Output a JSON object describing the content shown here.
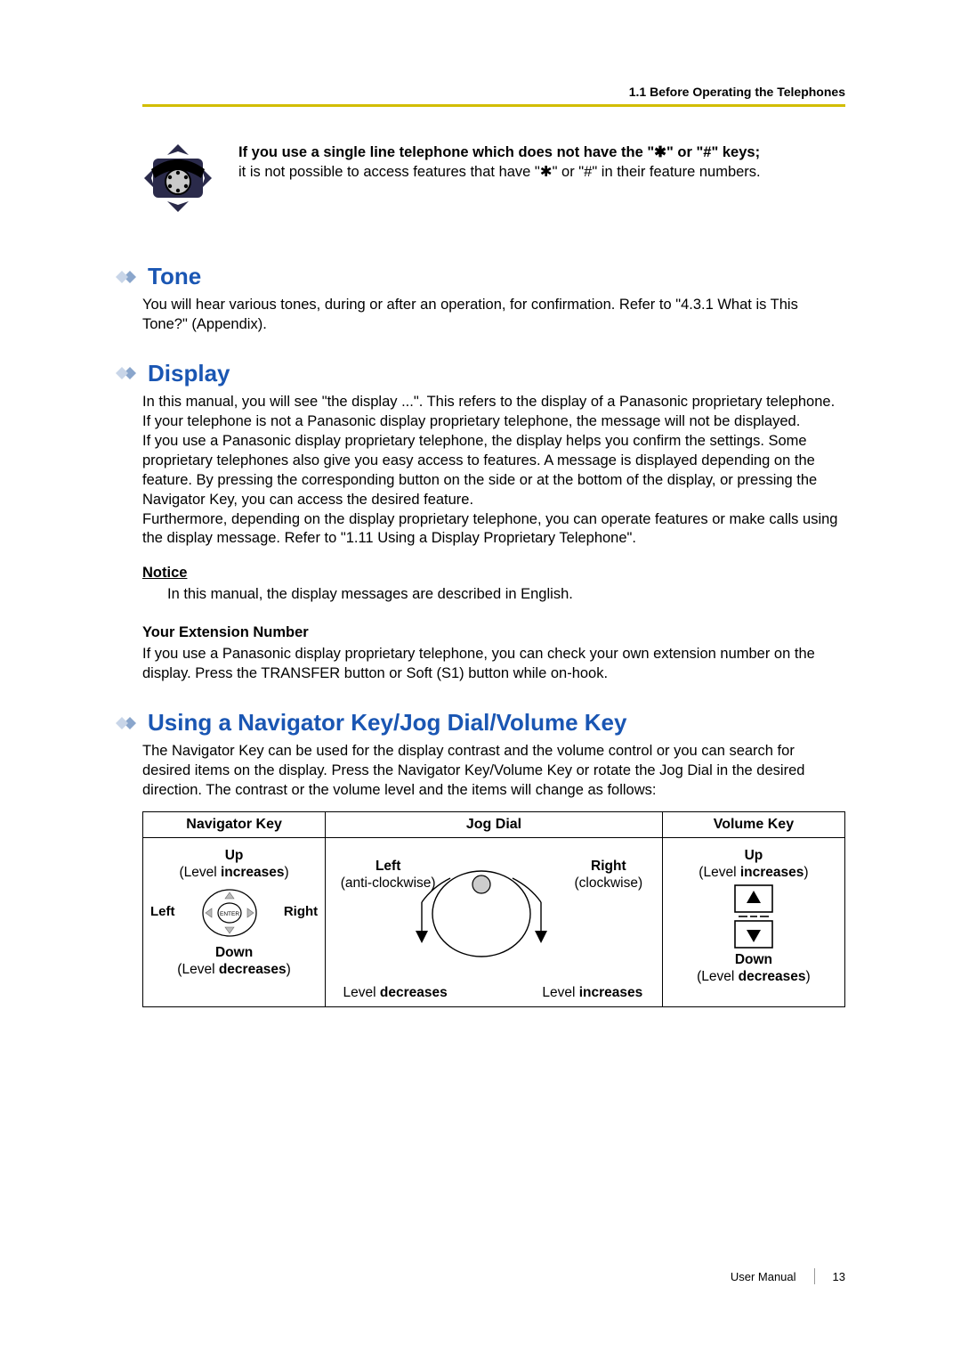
{
  "header": {
    "section": "1.1 Before Operating the Telephones"
  },
  "note": {
    "line1": "If you use a single line telephone which does not have the \"✱\" or \"#\" keys;",
    "line2": "it is not possible to access features that have \"✱\" or \"#\" in their feature numbers."
  },
  "tone": {
    "title": "Tone",
    "body": "You will hear various tones, during or after an operation, for confirmation. Refer to \"4.3.1 What is This Tone?\" (Appendix)."
  },
  "display": {
    "title": "Display",
    "para1": "In this manual, you will see \"the display ...\". This refers to the display of a Panasonic proprietary telephone. If your telephone is not a Panasonic display proprietary telephone, the message will not be displayed.",
    "para2": "If you use a Panasonic display proprietary telephone, the display helps you confirm the settings. Some proprietary telephones also give you easy access to features. A message is displayed depending on the feature. By pressing the corresponding button on the side or at the bottom of the display, or pressing the Navigator Key, you can access the desired feature.",
    "para3": "Furthermore, depending on the display proprietary telephone, you can operate features or make calls using the display message. Refer to \"1.11 Using a Display Proprietary Telephone\".",
    "notice_label": "Notice",
    "notice_body": "In this manual, the display messages are described in English.",
    "ext_label": "Your Extension Number",
    "ext_body": "If you use a Panasonic display proprietary telephone, you can check your own extension number on the display. Press the TRANSFER button or Soft (S1) button while on-hook."
  },
  "nav": {
    "title": "Using a Navigator Key/Jog Dial/Volume Key",
    "intro": "The Navigator Key can be used for the display contrast and the volume control or you can search for desired items on the display. Press the Navigator Key/Volume Key or rotate the Jog Dial in the desired direction. The contrast or the volume level and the items will change as follows:",
    "headers": {
      "c1": "Navigator Key",
      "c2": "Jog Dial",
      "c3": "Volume Key"
    },
    "cell1": {
      "up": "Up",
      "up_sub_a": "(Level ",
      "up_sub_b": "increases",
      "up_sub_c": ")",
      "left": "Left",
      "right": "Right",
      "enter": "ENTER",
      "down": "Down",
      "down_sub_a": "(Level ",
      "down_sub_b": "decreases",
      "down_sub_c": ")"
    },
    "cell2": {
      "left": "Left",
      "left_sub": "(anti-clockwise)",
      "right": "Right",
      "right_sub": "(clockwise)",
      "ldec_a": "Level ",
      "ldec_b": "decreases",
      "linc_a": "Level ",
      "linc_b": "increases"
    },
    "cell3": {
      "up": "Up",
      "up_sub_a": "(Level ",
      "up_sub_b": "increases",
      "up_sub_c": ")",
      "down": "Down",
      "down_sub_a": "(Level ",
      "down_sub_b": "decreases",
      "down_sub_c": ")"
    }
  },
  "footer": {
    "label": "User Manual",
    "page": "13"
  }
}
